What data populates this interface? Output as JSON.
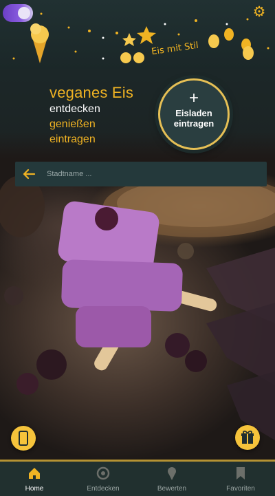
{
  "header": {
    "banner_title": "Eis mit Stil",
    "logo_icon": "moon-icon",
    "settings_icon": "gear-icon"
  },
  "hero": {
    "headline": "veganes Eis",
    "line2": "entdecken",
    "line3": "genießen",
    "line4": "eintragen"
  },
  "add_button": {
    "plus": "+",
    "label": "Eisladen eintragen"
  },
  "search": {
    "placeholder": "Stadtname ...",
    "value": ""
  },
  "fabs": {
    "left_icon": "phone-icon",
    "right_icon": "gift-icon"
  },
  "nav": {
    "items": [
      {
        "label": "Home",
        "icon": "home-icon",
        "active": true
      },
      {
        "label": "Entdecken",
        "icon": "compass-icon",
        "active": false
      },
      {
        "label": "Bewerten",
        "icon": "ice-cream-icon",
        "active": false
      },
      {
        "label": "Favoriten",
        "icon": "bookmark-icon",
        "active": false
      }
    ]
  },
  "colors": {
    "accent": "#f0b323",
    "background": "#1f2d2f",
    "nav_bg": "#21302f"
  }
}
